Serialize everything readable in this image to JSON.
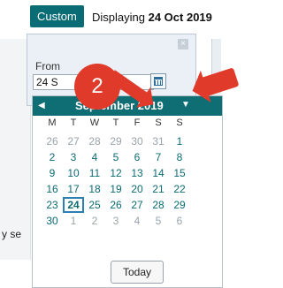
{
  "toolbar": {
    "custom_label": "Custom",
    "displaying_prefix": "Displaying",
    "displaying_date": "24 Oct 2019"
  },
  "date_panel": {
    "from_label": "From",
    "from_value": "24 S",
    "close_icon": "close-icon"
  },
  "annotation": {
    "step_number": "2"
  },
  "left_fragments": {
    "text": "y se"
  },
  "calendar": {
    "month_label": "September 2019",
    "weekday_labels": [
      "M",
      "T",
      "W",
      "T",
      "F",
      "S",
      "S"
    ],
    "weeks": [
      [
        {
          "d": "26",
          "other": true
        },
        {
          "d": "27",
          "other": true
        },
        {
          "d": "28",
          "other": true
        },
        {
          "d": "29",
          "other": true
        },
        {
          "d": "30",
          "other": true
        },
        {
          "d": "31",
          "other": true
        },
        {
          "d": "1",
          "other": false
        }
      ],
      [
        {
          "d": "2",
          "other": false
        },
        {
          "d": "3",
          "other": false
        },
        {
          "d": "4",
          "other": false
        },
        {
          "d": "5",
          "other": false
        },
        {
          "d": "6",
          "other": false
        },
        {
          "d": "7",
          "other": false
        },
        {
          "d": "8",
          "other": false
        }
      ],
      [
        {
          "d": "9",
          "other": false
        },
        {
          "d": "10",
          "other": false
        },
        {
          "d": "11",
          "other": false
        },
        {
          "d": "12",
          "other": false
        },
        {
          "d": "13",
          "other": false
        },
        {
          "d": "14",
          "other": false
        },
        {
          "d": "15",
          "other": false
        }
      ],
      [
        {
          "d": "16",
          "other": false
        },
        {
          "d": "17",
          "other": false
        },
        {
          "d": "18",
          "other": false
        },
        {
          "d": "19",
          "other": false
        },
        {
          "d": "20",
          "other": false
        },
        {
          "d": "21",
          "other": false
        },
        {
          "d": "22",
          "other": false
        }
      ],
      [
        {
          "d": "23",
          "other": false
        },
        {
          "d": "24",
          "other": false,
          "selected": true
        },
        {
          "d": "25",
          "other": false
        },
        {
          "d": "26",
          "other": false
        },
        {
          "d": "27",
          "other": false
        },
        {
          "d": "28",
          "other": false
        },
        {
          "d": "29",
          "other": false
        }
      ],
      [
        {
          "d": "30",
          "other": false
        },
        {
          "d": "1",
          "other": true
        },
        {
          "d": "2",
          "other": true
        },
        {
          "d": "3",
          "other": true
        },
        {
          "d": "4",
          "other": true
        },
        {
          "d": "5",
          "other": true
        },
        {
          "d": "6",
          "other": true
        }
      ]
    ],
    "today_label": "Today"
  }
}
